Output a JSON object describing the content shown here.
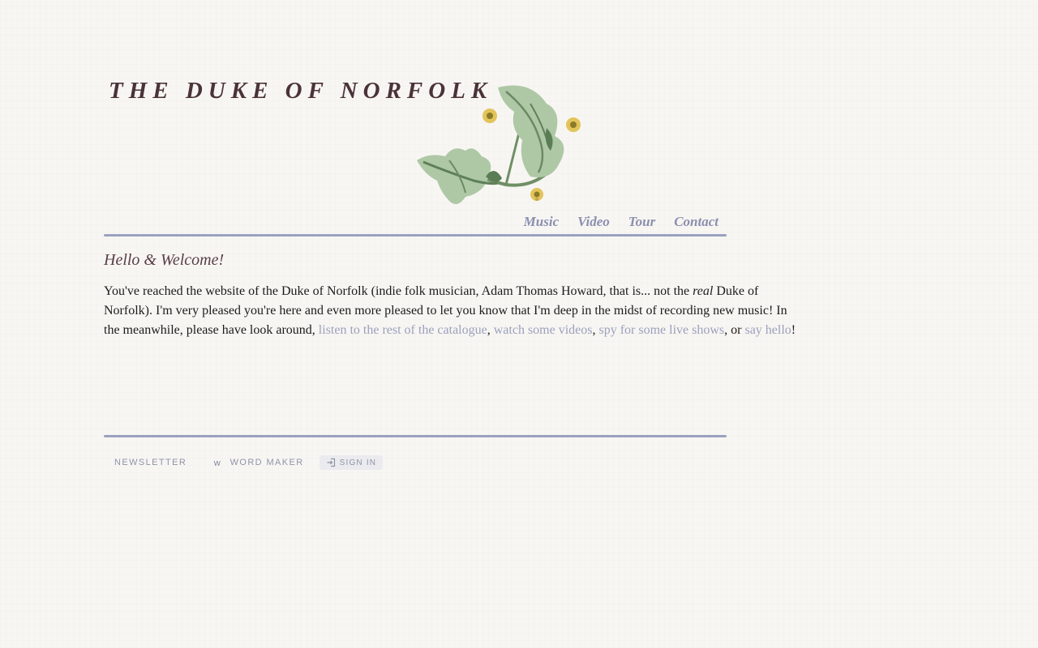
{
  "header": {
    "logo_text": "THE DUKE OF NORFOLK"
  },
  "nav": {
    "items": [
      {
        "label": "Music"
      },
      {
        "label": "Video"
      },
      {
        "label": "Tour"
      },
      {
        "label": "Contact"
      }
    ]
  },
  "main": {
    "heading": "Hello & Welcome!",
    "intro_part1": "You've reached the website of the Duke of Norfolk (indie folk musician, Adam Thomas Howard, that is... not the ",
    "intro_emphasis": "real",
    "intro_part2": " Duke of Norfolk). I'm very pleased you're here and even more pleased to let you know that I'm deep in the midst of recording new music! In the meanwhile, please have look around, ",
    "link_catalogue": "listen to the rest of the catalogue",
    "sep1": ", ",
    "link_videos": "watch some videos",
    "sep2": ", ",
    "link_shows": "spy for some live shows",
    "sep3": ", or ",
    "link_hello": "say hello",
    "intro_end": "!"
  },
  "footer": {
    "newsletter_label": "NEWSLETTER",
    "wordmaker_icon": "w",
    "wordmaker_label": "WORD MAKER",
    "signin_label": "SIGN IN"
  },
  "colors": {
    "background": "#f8f6f3",
    "link": "#9ba0bc",
    "nav": "#8a8fae",
    "rule": "#9aa2c0",
    "logo_text": "#4a3338",
    "leaf_green": "#a9c4a0",
    "flower_yellow": "#e2c45a"
  },
  "icons": {
    "logo_flourish": "floral-leaf-illustration",
    "signin": "sign-in-arrow-icon"
  }
}
